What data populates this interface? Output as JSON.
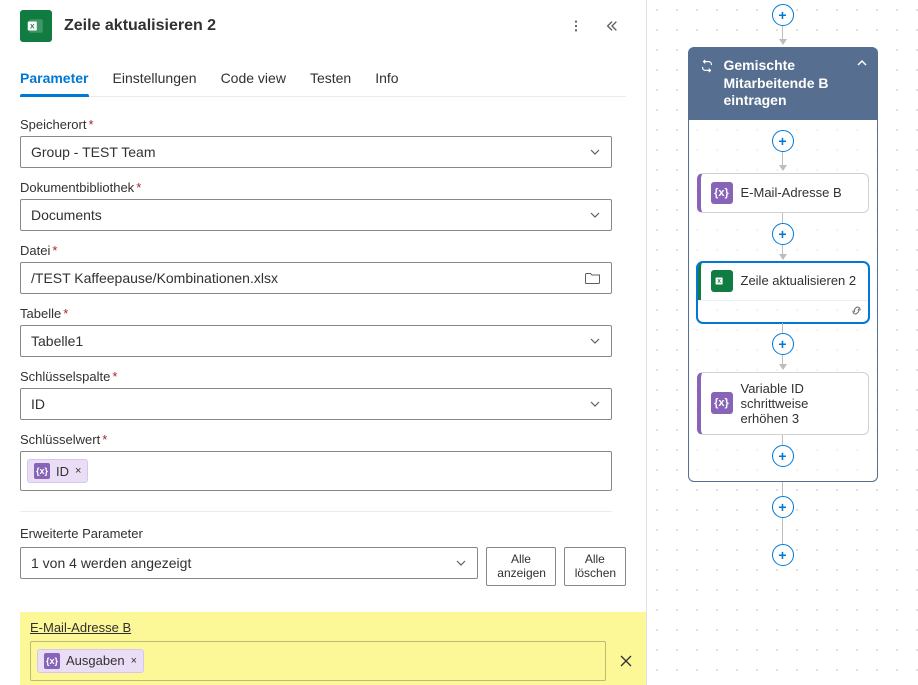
{
  "header": {
    "title": "Zeile aktualisieren 2"
  },
  "tabs": {
    "parameter": "Parameter",
    "settings": "Einstellungen",
    "codeview": "Code view",
    "test": "Testen",
    "info": "Info"
  },
  "fields": {
    "location_label": "Speicherort",
    "location_value": "Group - TEST Team",
    "library_label": "Dokumentbibliothek",
    "library_value": "Documents",
    "file_label": "Datei",
    "file_value": "/TEST Kaffeepause/Kombinationen.xlsx",
    "table_label": "Tabelle",
    "table_value": "Tabelle1",
    "keycol_label": "Schlüsselspalte",
    "keycol_value": "ID",
    "keyval_label": "Schlüsselwert",
    "keyval_token": "ID"
  },
  "advanced": {
    "label": "Erweiterte Parameter",
    "dropdown_value": "1 von 4 werden angezeigt",
    "show_all_line1": "Alle",
    "show_all_line2": "anzeigen",
    "clear_all_line1": "Alle",
    "clear_all_line2": "löschen"
  },
  "highlight": {
    "label": "E-Mail-Adresse B",
    "token": "Ausgaben"
  },
  "flow": {
    "loop_title": "Gemischte Mitarbeitende B eintragen",
    "step_email": "E-Mail-Adresse B",
    "step_update": "Zeile aktualisieren 2",
    "step_increment": "Variable ID schrittweise erhöhen 3"
  }
}
